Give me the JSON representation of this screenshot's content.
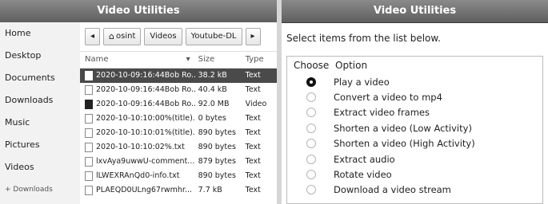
{
  "left_window": {
    "title": "Video Utilities",
    "places": [
      "Home",
      "Desktop",
      "Documents",
      "Downloads",
      "Music",
      "Pictures",
      "Videos",
      "+ Downloads"
    ],
    "pathbar": {
      "back_glyph": "◂",
      "forward_glyph": "▸",
      "crumbs": [
        "osint",
        "Videos",
        "Youtube-DL"
      ]
    },
    "columns": {
      "name": "Name",
      "sort_glyph": "▾",
      "size": "Size",
      "type": "Type"
    },
    "files": [
      {
        "name": "2020-10-09:16:44Bob Ro...",
        "size": "38.2 kB",
        "type": "Text",
        "icon": "text-file-icon",
        "selected": true
      },
      {
        "name": "2020-10-09:16:44Bob Ro...",
        "size": "40.4 kB",
        "type": "Text",
        "icon": "text-file-icon",
        "selected": false
      },
      {
        "name": "2020-10-09:16:44Bob Ro...",
        "size": "92.0 MB",
        "type": "Video",
        "icon": "video-file-icon",
        "selected": false
      },
      {
        "name": "2020-10-10:10:00%(title)...",
        "size": "0 bytes",
        "type": "Text",
        "icon": "text-file-icon",
        "selected": false
      },
      {
        "name": "2020-10-10:10:01%(title)...",
        "size": "890 bytes",
        "type": "Text",
        "icon": "text-file-icon",
        "selected": false
      },
      {
        "name": "2020-10-10:10:02%.txt",
        "size": "890 bytes",
        "type": "Text",
        "icon": "text-file-icon",
        "selected": false
      },
      {
        "name": "lxvAya9uwwU-comment...",
        "size": "879 bytes",
        "type": "Text",
        "icon": "text-file-icon",
        "selected": false
      },
      {
        "name": "lLWEXRAnQd0-info.txt",
        "size": "890 bytes",
        "type": "Text",
        "icon": "text-file-icon",
        "selected": false
      },
      {
        "name": "PLAEQD0ULng67rwmhr...",
        "size": "7.7 kB",
        "type": "Text",
        "icon": "text-file-icon",
        "selected": false
      }
    ]
  },
  "right_window": {
    "title": "Video Utilities",
    "instruction": "Select items from the list below.",
    "headers": {
      "choose": "Choose",
      "option": "Option"
    },
    "options": [
      {
        "label": "Play a video",
        "selected": true
      },
      {
        "label": "Convert a video to mp4",
        "selected": false
      },
      {
        "label": "Extract video frames",
        "selected": false
      },
      {
        "label": "Shorten a video (Low Activity)",
        "selected": false
      },
      {
        "label": "Shorten a video (High Activity)",
        "selected": false
      },
      {
        "label": "Extract audio",
        "selected": false
      },
      {
        "label": "Rotate video",
        "selected": false
      },
      {
        "label": "Download a video stream",
        "selected": false
      }
    ]
  }
}
